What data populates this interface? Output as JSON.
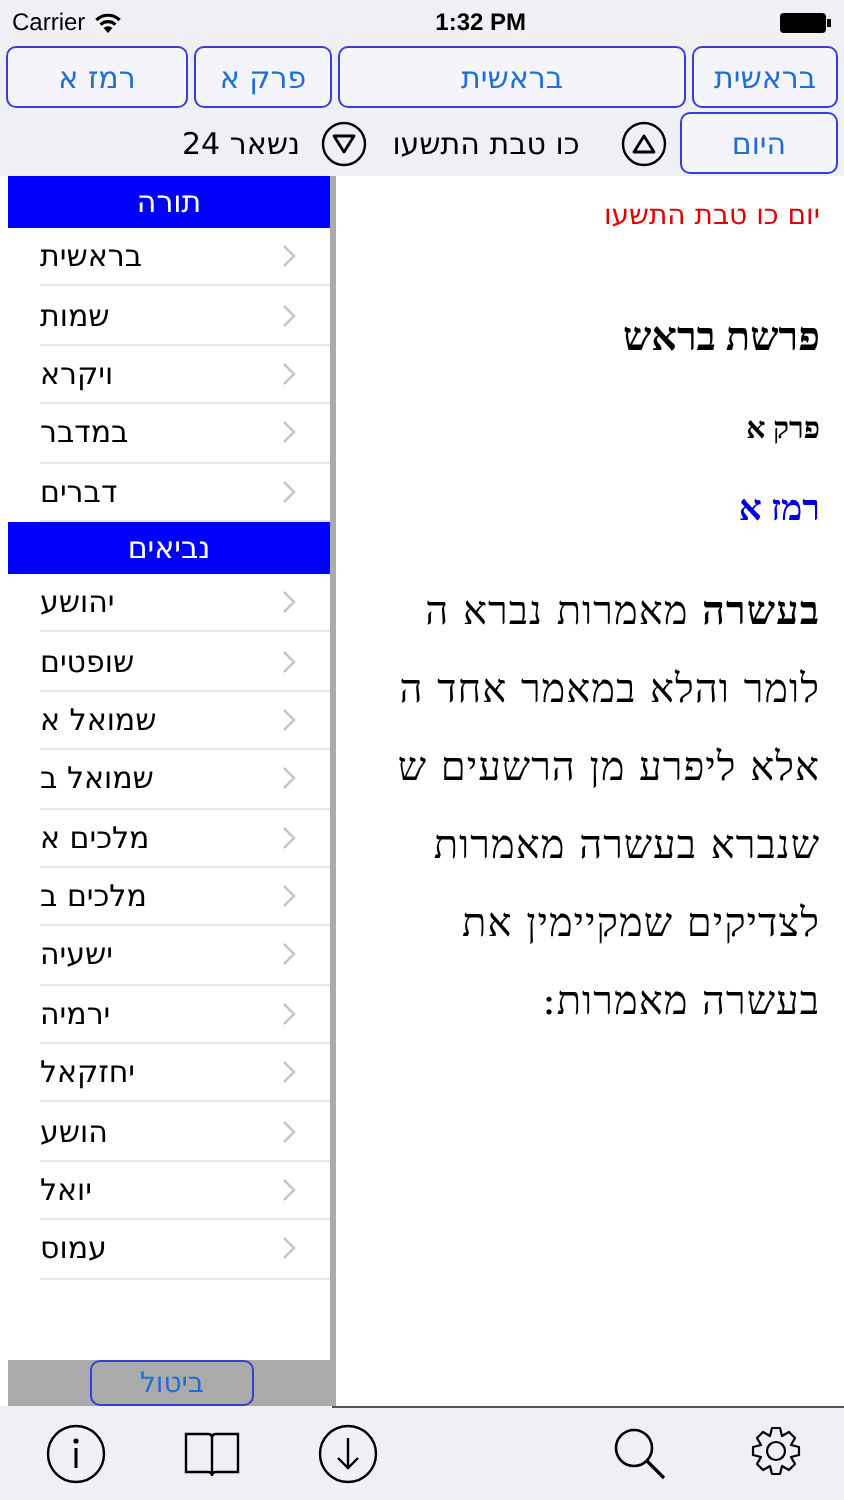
{
  "status_bar": {
    "carrier": "Carrier",
    "time": "1:32 PM"
  },
  "nav_buttons": [
    {
      "label": "בראשית"
    },
    {
      "label": "בראשית"
    },
    {
      "label": "פרק א"
    },
    {
      "label": "רמז א"
    }
  ],
  "date_bar": {
    "remaining": "נשאר 24",
    "date": "כו טבת התשעו",
    "today_button": "היום"
  },
  "content": {
    "date_line": "יום כו טבת התשעו",
    "title": "פרשת בראש",
    "chapter": "פרק א",
    "remez": "רמז א",
    "lines": [
      "**בעשרה** מאמרות נברא ה",
      "לומר והלא במאמר אחד ה",
      "אלא ליפרע מן הרשעים ש",
      "שנברא בעשרה מאמרות",
      "לצדיקים שמקיימין את",
      "בעשרה מאמרות:"
    ]
  },
  "book_panel": {
    "sections": [
      {
        "title": "תורה",
        "items": [
          "בראשית",
          "שמות",
          "ויקרא",
          "במדבר",
          "דברים"
        ]
      },
      {
        "title": "נביאים",
        "items": [
          "יהושע",
          "שופטים",
          "שמואל א",
          "שמואל ב",
          "מלכים א",
          "מלכים ב",
          "ישעיה",
          "ירמיה",
          "יחזקאל",
          "הושע",
          "יואל",
          "עמוס"
        ]
      }
    ],
    "cancel_button": "ביטול"
  }
}
